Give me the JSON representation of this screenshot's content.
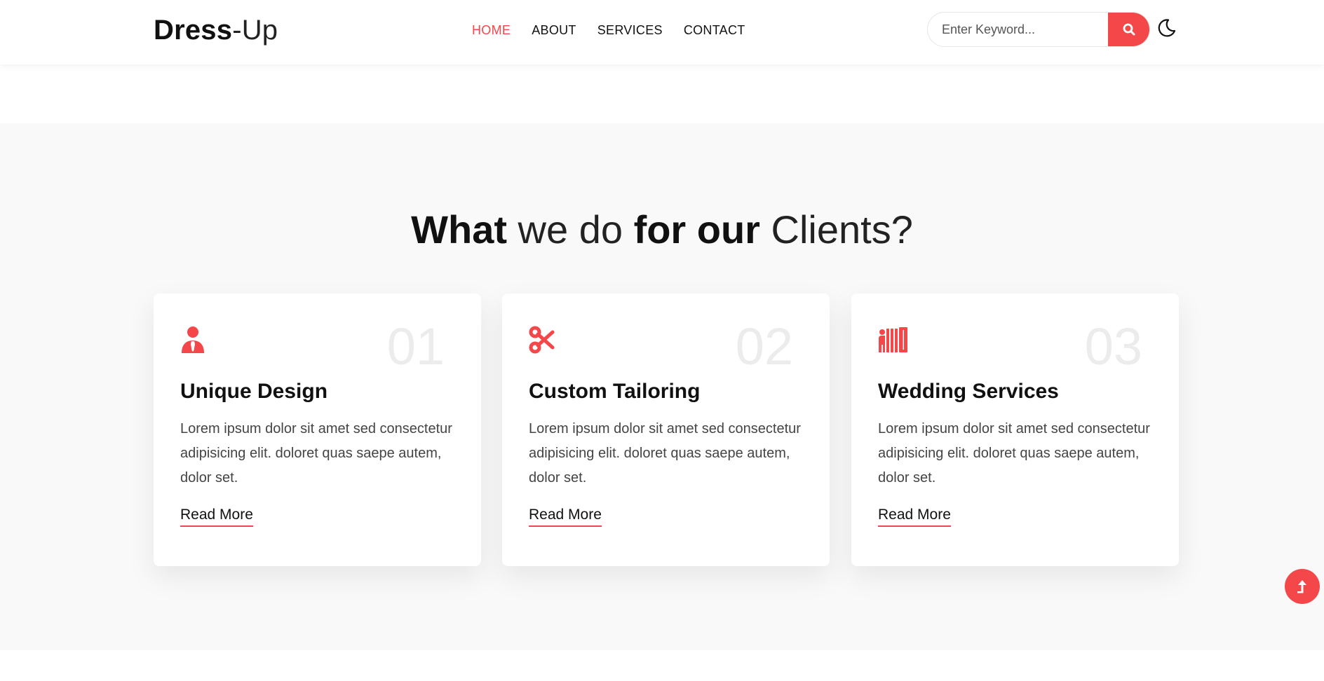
{
  "brand": {
    "bold": "Dress",
    "light": "-Up"
  },
  "nav": {
    "items": [
      {
        "label": "HOME",
        "active": true
      },
      {
        "label": "ABOUT",
        "active": false
      },
      {
        "label": "SERVICES",
        "active": false
      },
      {
        "label": "CONTACT",
        "active": false
      }
    ]
  },
  "search": {
    "placeholder": "Enter Keyword...",
    "icon": "search-icon"
  },
  "theme_toggle": {
    "icon": "moon-icon"
  },
  "section": {
    "title_part1": "What",
    "title_part2": " we do ",
    "title_part3": "for our",
    "title_part4": " Clients?"
  },
  "cards": [
    {
      "number": "01",
      "icon": "person-tie-icon",
      "title": "Unique Design",
      "description": "Lorem ipsum dolor sit amet sed consectetur adipisicing elit. doloret quas saepe autem, dolor set.",
      "link": "Read More"
    },
    {
      "number": "02",
      "icon": "scissors-icon",
      "title": "Custom Tailoring",
      "description": "Lorem ipsum dolor sit amet sed consectetur adipisicing elit. doloret quas saepe autem, dolor set.",
      "link": "Read More"
    },
    {
      "number": "03",
      "icon": "wardrobe-person-icon",
      "title": "Wedding Services",
      "description": "Lorem ipsum dolor sit amet sed consectetur adipisicing elit. doloret quas saepe autem, dolor set.",
      "link": "Read More"
    }
  ],
  "scroll_top": {
    "icon": "arrow-up-icon"
  },
  "colors": {
    "accent": "#f4474a",
    "section_bg": "#f9f9f9",
    "number_color": "#ececec"
  }
}
